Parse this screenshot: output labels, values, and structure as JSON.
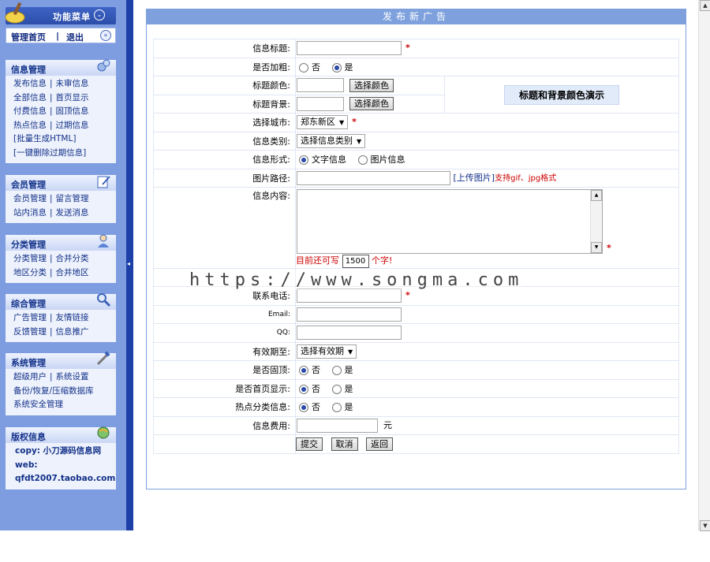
{
  "sidebar": {
    "top_title": "功能菜单",
    "home_link": "管理首页",
    "sep": "|",
    "logout_link": "退出",
    "boxes": [
      {
        "title": "信息管理",
        "rows": [
          [
            "发布信息",
            "未审信息"
          ],
          [
            "全部信息",
            "首页显示"
          ],
          [
            "付费信息",
            "固顶信息"
          ],
          [
            "热点信息",
            "过期信息"
          ],
          [
            "[批量生成HTML]"
          ],
          [
            "[一键删除过期信息]"
          ]
        ]
      },
      {
        "title": "会员管理",
        "rows": [
          [
            "会员管理",
            "留言管理"
          ],
          [
            "站内消息",
            "发送消息"
          ]
        ]
      },
      {
        "title": "分类管理",
        "rows": [
          [
            "分类管理",
            "合并分类"
          ],
          [
            "地区分类",
            "合并地区"
          ]
        ]
      },
      {
        "title": "综合管理",
        "rows": [
          [
            "广告管理",
            "友情链接"
          ],
          [
            "反馈管理",
            "信息推广"
          ]
        ]
      },
      {
        "title": "系统管理",
        "rows": [
          [
            "超级用户",
            "系统设置"
          ],
          [
            "备份/恢复/压缩数据库"
          ],
          [
            "系统安全管理"
          ]
        ]
      },
      {
        "title": "版权信息",
        "rows": [
          [
            "copy: 小刀源码信息网"
          ],
          [
            "web:"
          ],
          [
            "qfdt2007.taobao.com"
          ]
        ]
      }
    ]
  },
  "main": {
    "caption": "发布新广告",
    "labels": {
      "title": "信息标题:",
      "bold": "是否加粗:",
      "title_color": "标题颜色:",
      "title_bg": "标题背景:",
      "city": "选择城市:",
      "category": "信息类别:",
      "form": "信息形式:",
      "img_path": "图片路径:",
      "content": "信息内容:",
      "phone": "联系电话:",
      "email": "Email:",
      "qq": "QQ:",
      "valid_until": "有效期至:",
      "pinned": "是否固顶:",
      "homepage": "是否首页显示:",
      "hot": "热点分类信息:",
      "fee": "信息费用:"
    },
    "no": "否",
    "yes": "是",
    "pick_color": "选择颜色",
    "color_demo": "标题和背景颜色演示",
    "city_value": "郑东新区",
    "category_value": "选择信息类别",
    "form_text": "文字信息",
    "form_image": "图片信息",
    "upload_link": "[上传图片]",
    "upload_hint": "支持gif、jpg格式",
    "remain_label": "目前还可写",
    "remain_count": "1500",
    "remain_unit": "个字!",
    "valid_value": "选择有效期",
    "fee_unit": "元",
    "submit": "提交",
    "cancel": "取消",
    "back": "返回",
    "star": "*"
  },
  "watermark": "https://www.songma.com",
  "colors": {
    "sidebar_bg": "#7e9ce0",
    "caption_bg": "#7ea1dd",
    "required": "#cc0000"
  }
}
